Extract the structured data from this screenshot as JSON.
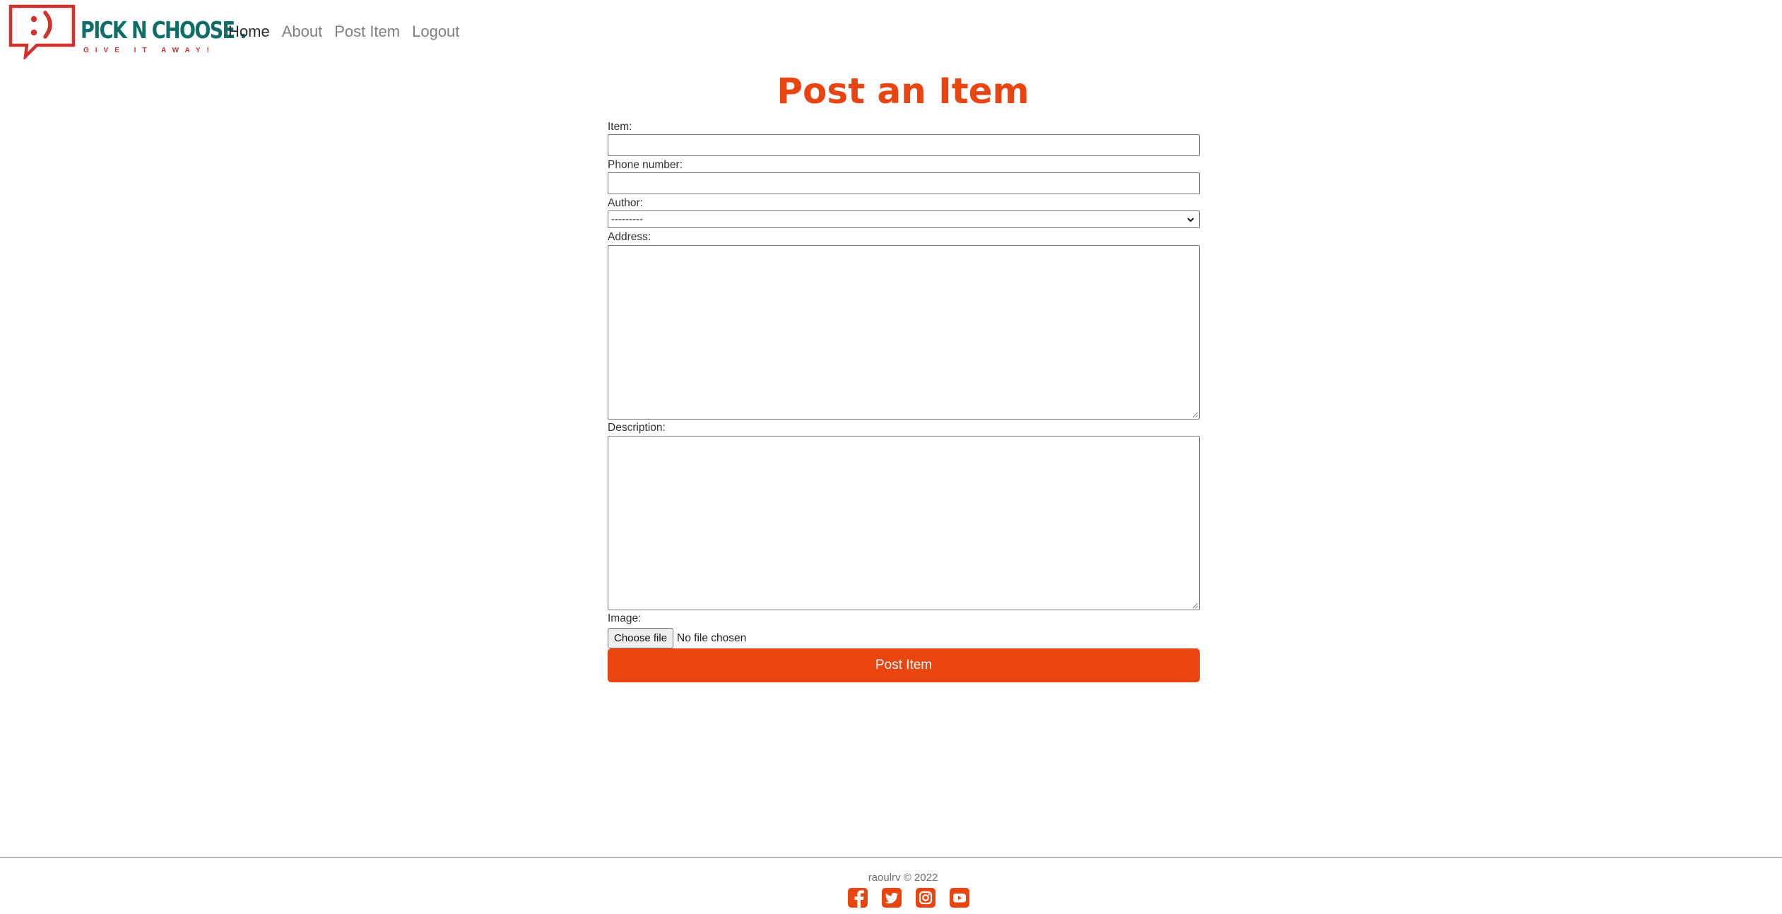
{
  "brand": {
    "name": "PICK N CHOOSE",
    "dot": ".",
    "tagline": "GIVE IT AWAY!",
    "colors": {
      "teal": "#0f6d6a",
      "red": "#d2322d"
    }
  },
  "nav": {
    "items": [
      {
        "label": "Home",
        "active": true
      },
      {
        "label": "About",
        "active": false
      },
      {
        "label": "Post Item",
        "active": false
      },
      {
        "label": "Logout",
        "active": false
      }
    ]
  },
  "page": {
    "title": "Post an Item",
    "accent_color": "#e84511"
  },
  "form": {
    "item": {
      "label": "Item:",
      "value": ""
    },
    "phone": {
      "label": "Phone number:",
      "value": ""
    },
    "author": {
      "label": "Author:",
      "selected": "---------"
    },
    "address": {
      "label": "Address:",
      "value": ""
    },
    "description": {
      "label": "Description:",
      "value": ""
    },
    "image": {
      "label": "Image:",
      "button": "Choose file",
      "status": "No file chosen"
    },
    "submit_label": "Post Item"
  },
  "footer": {
    "copyright": "raoulrv © 2022",
    "social_icons": [
      "facebook-icon",
      "twitter-icon",
      "instagram-icon",
      "youtube-icon"
    ]
  }
}
